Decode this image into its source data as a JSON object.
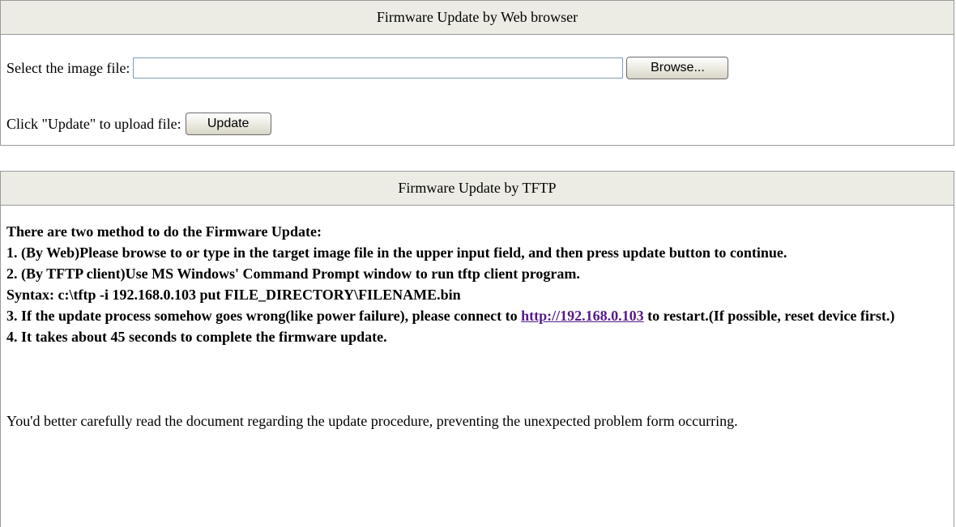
{
  "web_panel": {
    "title": "Firmware Update by Web browser",
    "select_label": "Select the image file:",
    "file_value": "",
    "browse_label": "Browse...",
    "update_prompt": "Click \"Update\" to upload file:",
    "update_label": "Update"
  },
  "tftp_panel": {
    "title": "Firmware Update by TFTP",
    "intro": "There are two method to do the Firmware Update:",
    "step1": "1. (By Web)Please browse to or type in the target image file in the upper input field, and then press update button to continue.",
    "step2": "2. (By TFTP client)Use MS Windows' Command Prompt window to run tftp client program.",
    "syntax": "Syntax: c:\\tftp -i 192.168.0.103 put FILE_DIRECTORY\\FILENAME.bin",
    "step3_pre": "3. If the update process somehow goes wrong(like power failure), please connect to ",
    "step3_link": "http://192.168.0.103",
    "step3_post": " to restart.(If possible, reset device first.)",
    "step4": "4. It takes about 45 seconds to complete the firmware update.",
    "note": "You'd better carefully read the document regarding the update procedure, preventing the unexpected problem form occurring."
  },
  "colors": {
    "header_bg": "#ecece4",
    "border": "#9a9a9a",
    "link": "#551a8b"
  }
}
